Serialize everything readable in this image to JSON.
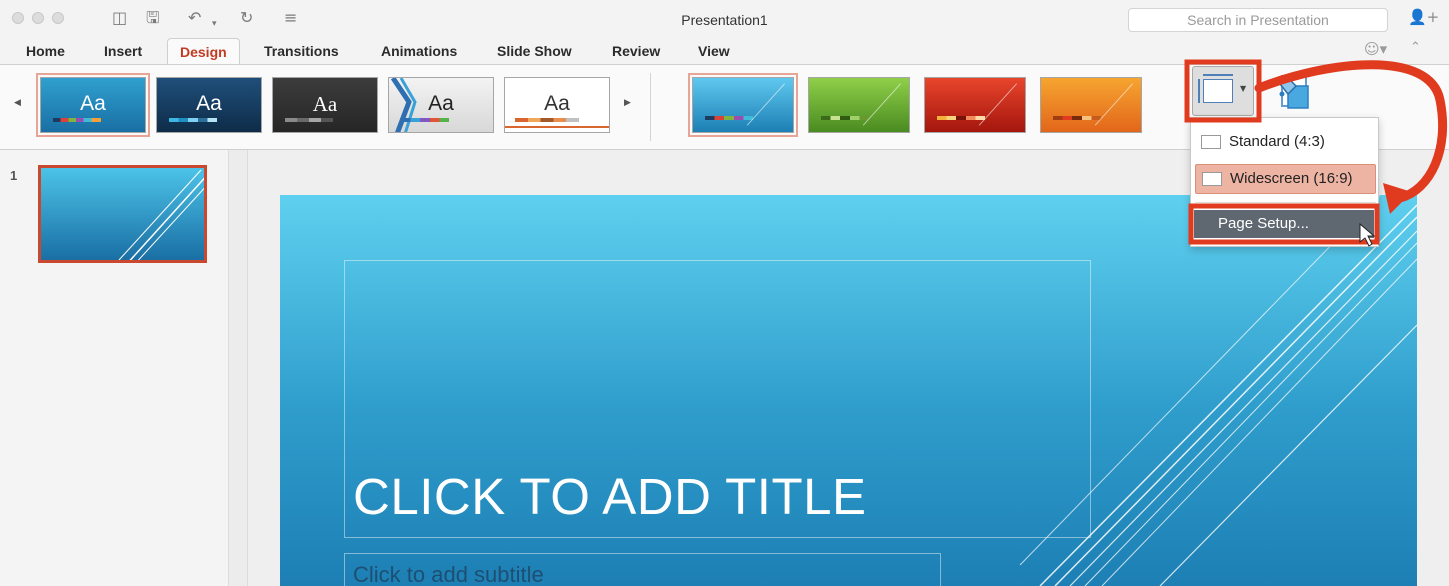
{
  "window": {
    "title": "Presentation1",
    "search_placeholder": "Search in Presentation"
  },
  "toolbar": {
    "icons": [
      "traffic-light-close",
      "traffic-light-minimize",
      "traffic-light-zoom",
      "sidebar-icon",
      "save-icon",
      "undo-icon",
      "redo-icon",
      "customize-icon",
      "share-icon"
    ]
  },
  "ribbon": {
    "tabs": [
      {
        "label": "Home"
      },
      {
        "label": "Insert"
      },
      {
        "label": "Design",
        "active": true
      },
      {
        "label": "Transitions"
      },
      {
        "label": "Animations"
      },
      {
        "label": "Slide Show"
      },
      {
        "label": "Review"
      },
      {
        "label": "View"
      }
    ],
    "themes": [
      {
        "label": "Aa",
        "colors": [
          "#2fa0cf",
          "#1a6fa4"
        ],
        "selected": true
      },
      {
        "label": "Aa",
        "colors": [
          "#1f4f7a",
          "#0e2c49"
        ]
      },
      {
        "label": "Aa",
        "colors": [
          "#3c3c3c",
          "#262626"
        ]
      },
      {
        "label": "Aa",
        "colors": [
          "#f3f3f3",
          "#d8d8d8"
        ]
      },
      {
        "label": "Aa",
        "colors": [
          "#ffffff",
          "#f4f4f4"
        ]
      }
    ],
    "variants": [
      {
        "colors": [
          "#5fc8ef",
          "#1d7fb4"
        ],
        "selected": true
      },
      {
        "colors": [
          "#8fcf49",
          "#4a8b21"
        ]
      },
      {
        "colors": [
          "#e8452c",
          "#a4160d"
        ]
      },
      {
        "colors": [
          "#f6a531",
          "#e2661a"
        ]
      }
    ],
    "slide_size_button": "slide-size-icon",
    "format_background_button": "format-background-icon",
    "accent_color": "#c23b22"
  },
  "slide_size_menu": {
    "items": [
      {
        "label": "Standard (4:3)"
      },
      {
        "label": "Widescreen (16:9)",
        "selected": true
      }
    ],
    "page_setup": "Page Setup..."
  },
  "thumbnails": [
    {
      "number": "1"
    }
  ],
  "slide": {
    "title": "CLICK TO ADD TITLE",
    "subtitle": "Click to add subtitle"
  },
  "annotation_color": "#e03a1f"
}
